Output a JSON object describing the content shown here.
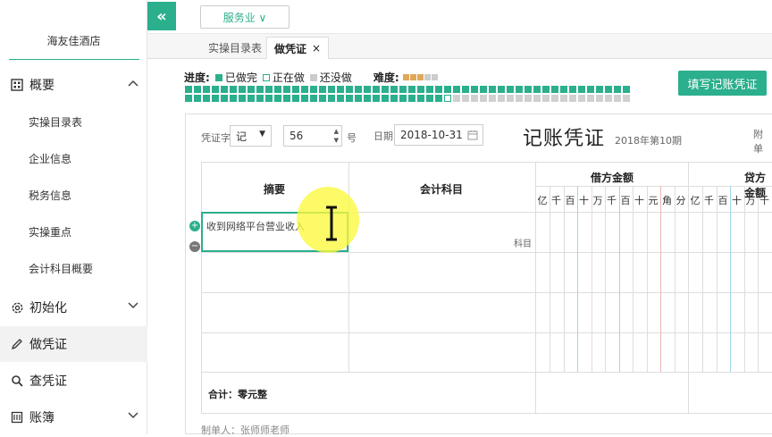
{
  "sidebar": {
    "company": "海友佳酒店",
    "overview": "概要",
    "overview_items": [
      "实操目录表",
      "企业信息",
      "税务信息",
      "实操重点",
      "会计科目概要"
    ],
    "init": "初始化",
    "make_voucher": "做凭证",
    "query_voucher": "查凭证",
    "ledger": "账簿"
  },
  "topbar": {
    "collapse": "«",
    "industry": "服务业 ∨"
  },
  "tabs": [
    {
      "label": "实操目录表"
    },
    {
      "label": "做凭证",
      "close": "×"
    }
  ],
  "progress": {
    "label": "进度:",
    "done": "已做完",
    "doing": "正在做",
    "todo": "还没做",
    "difficulty_label": "难度:",
    "difficulty": 3,
    "difficulty_max": 5,
    "total_tasks": 100,
    "completed_tasks": 79,
    "current_task": 80,
    "colors": {
      "done": "#2baf8c",
      "todo": "#d0d0d0",
      "accent": "#2baf8c"
    }
  },
  "fill_button": "填写记账凭证",
  "voucher": {
    "type_label": "凭证字",
    "type_value": "记",
    "number": "56",
    "number_suffix": "号",
    "date_label": "日期",
    "date": "2018-10-31",
    "title": "记账凭证",
    "period": "2018年第10期",
    "attach_label": "附单",
    "columns": {
      "summary": "摘要",
      "account": "会计科目",
      "debit": "借方金额",
      "credit": "贷方金额"
    },
    "debit_digits": [
      "亿",
      "千",
      "百",
      "十",
      "万",
      "千",
      "百",
      "十",
      "元",
      "角",
      "分"
    ],
    "credit_digits": [
      "亿",
      "千",
      "百",
      "十",
      "万",
      "千"
    ],
    "rows": [
      {
        "summary": "收到网络平台营业收入",
        "account_placeholder": "科目"
      }
    ],
    "total": "合计：零元整",
    "maker": "制单人：张师师老师"
  }
}
